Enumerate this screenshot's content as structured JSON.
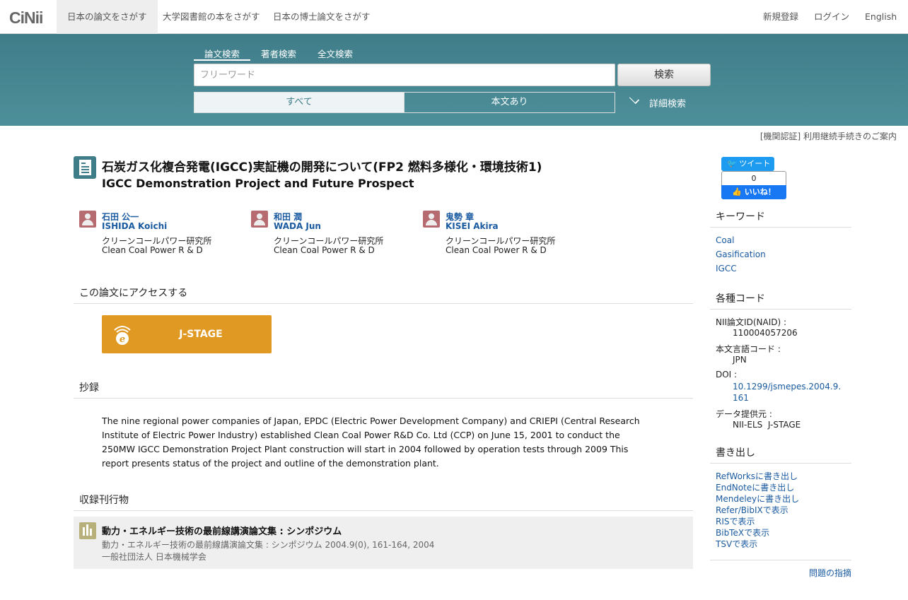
{
  "nav": {
    "logo": "CiNii",
    "tabs": [
      "日本の論文をさがす",
      "大学図書館の本をさがす",
      "日本の博士論文をさがす"
    ],
    "register": "新規登録",
    "login": "ログイン",
    "language": "English"
  },
  "search": {
    "tabs": [
      "論文検索",
      "著者検索",
      "全文検索"
    ],
    "placeholder": "フリーワード",
    "button": "検索",
    "filter_all": "すべて",
    "filter_fulltext": "本文あり",
    "advanced": "詳細検索"
  },
  "notice": "[機関認証] 利用継続手続きのご案内",
  "article": {
    "title_ja": "石炭ガス化複合発電(IGCC)実証機の開発について(FP2 燃料多様化・環境技術1)",
    "title_en": "IGCC Demonstration Project and Future Prospect",
    "authors": [
      {
        "name_ja": "石田 公一",
        "name_en": "ISHIDA Koichi",
        "affil_ja": "クリーンコールパワー研究所",
        "affil_en": "Clean Coal Power R & D"
      },
      {
        "name_ja": "和田 潤",
        "name_en": "WADA Jun",
        "affil_ja": "クリーンコールパワー研究所",
        "affil_en": "Clean Coal Power R & D"
      },
      {
        "name_ja": "鬼勢 章",
        "name_en": "KISEI Akira",
        "affil_ja": "クリーンコールパワー研究所",
        "affil_en": "Clean Coal Power R & D"
      }
    ],
    "access_heading": "この論文にアクセスする",
    "jstage_label": "J-STAGE",
    "abstract_heading": "抄録",
    "abstract": "The nine regional power companies of Japan, EPDC (Electric Power Development Company) and CRIEPI (Central Research Institute of Electric Power Industry) established Clean Coal Power R&D Co. Ltd (CCP) on June 15, 2001 to conduct the 250MW IGCC Demonstration Project Plant construction will start in 2004 followed by operation tests through 2009 This report presents status of the project and outline of the demonstration plant.",
    "journal_heading": "収録刊行物",
    "journal": {
      "title": "動力・エネルギー技術の最前線講演論文集 : シンポジウム",
      "citation": "動力・エネルギー技術の最前線講演論文集 : シンポジウム 2004.9(0), 161-164, 2004",
      "publisher": "一般社団法人 日本機械学会"
    }
  },
  "sidebar": {
    "tweet": "ツイート",
    "like_count": "0",
    "like": "いいね！",
    "keywords_heading": "キーワード",
    "keywords": [
      "Coal",
      "Gasification",
      "IGCC"
    ],
    "codes_heading": "各種コード",
    "codes": [
      {
        "key": "NII論文ID(NAID) :",
        "value": "110004057206"
      },
      {
        "key": "本文言語コード :",
        "value": "JPN"
      },
      {
        "key": "DOI :",
        "value": "10.1299/jsmepes.2004.9.161"
      },
      {
        "key": "データ提供元 :",
        "value": "NII-ELS  J-STAGE"
      }
    ],
    "export_heading": "書き出し",
    "exports": [
      "RefWorksに書き出し",
      "EndNoteに書き出し",
      "Mendeleyに書き出し",
      "Refer/BibIXで表示",
      "RISで表示",
      "BibTeXで表示",
      "TSVで表示"
    ],
    "report": "問題の指摘"
  }
}
